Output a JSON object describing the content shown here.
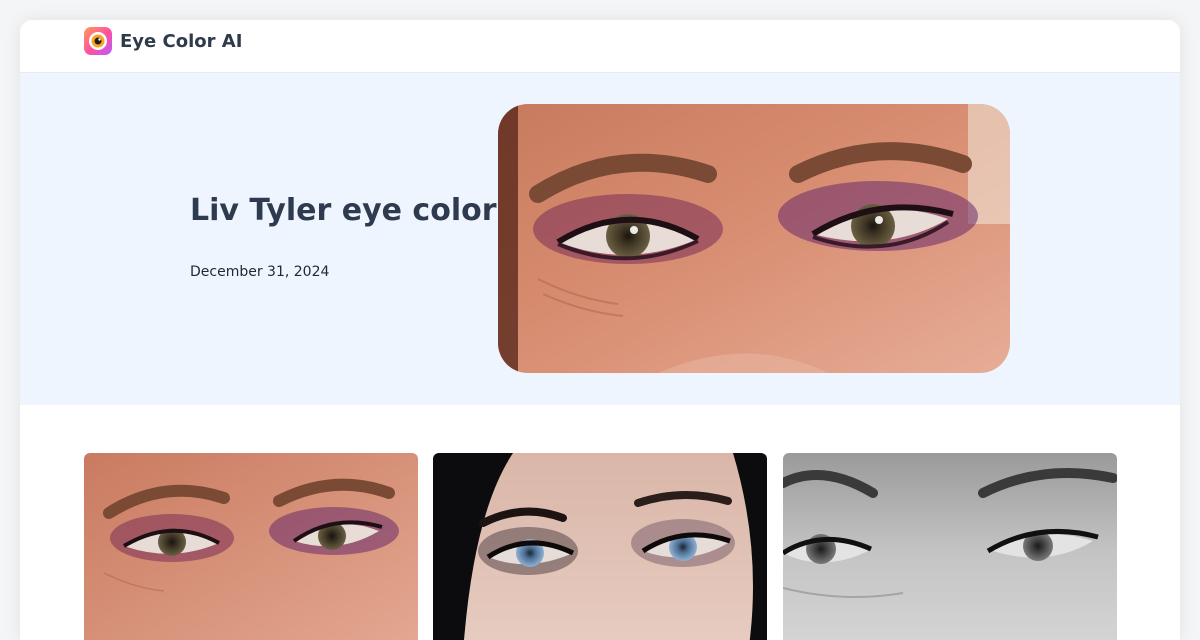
{
  "header": {
    "brand": "Eye Color AI",
    "logo_icon": "eye-logo-icon"
  },
  "hero": {
    "title": "Liv Tyler eye color",
    "date": "December 31, 2024",
    "image": "close-up of eyes with purple eyeshadow"
  },
  "gallery": [
    {
      "image": "close-up of eyes with purple eyeshadow"
    },
    {
      "image": "blue eyes framed by dark hair"
    },
    {
      "image": "black-and-white close-up of eyes"
    }
  ],
  "colors": {
    "hero_bg": "#eef5ff",
    "title": "#2e3a4d",
    "logo_gradient_start": "#ff9a5a",
    "logo_gradient_end": "#b65cff"
  }
}
